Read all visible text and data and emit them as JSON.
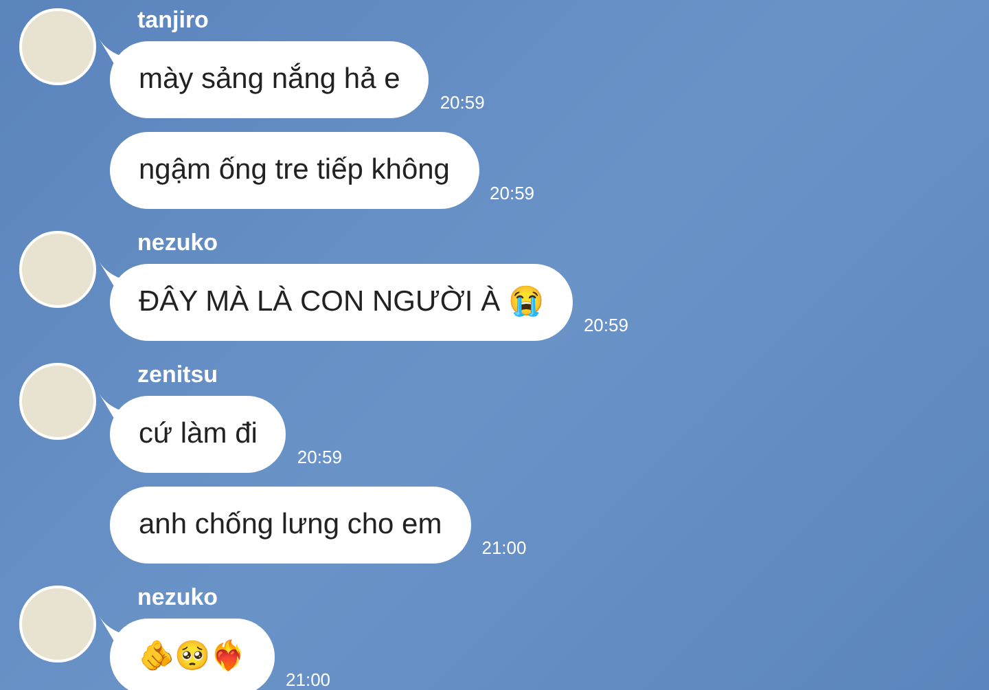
{
  "groups": [
    {
      "sender": "tanjiro",
      "messages": [
        {
          "text": "mày sảng nắng hả e",
          "time": "20:59"
        },
        {
          "text": "ngậm ống tre tiếp không",
          "time": "20:59"
        }
      ]
    },
    {
      "sender": "nezuko",
      "messages": [
        {
          "text": "ĐÂY MÀ LÀ CON NGƯỜI À 😭",
          "time": "20:59"
        }
      ]
    },
    {
      "sender": "zenitsu",
      "messages": [
        {
          "text": "cứ làm đi",
          "time": "20:59"
        },
        {
          "text": "anh chống lưng cho em",
          "time": "21:00"
        }
      ]
    },
    {
      "sender": "nezuko",
      "messages": [
        {
          "text": "🫵🥺❤️‍🔥",
          "time": "21:00"
        }
      ]
    }
  ]
}
